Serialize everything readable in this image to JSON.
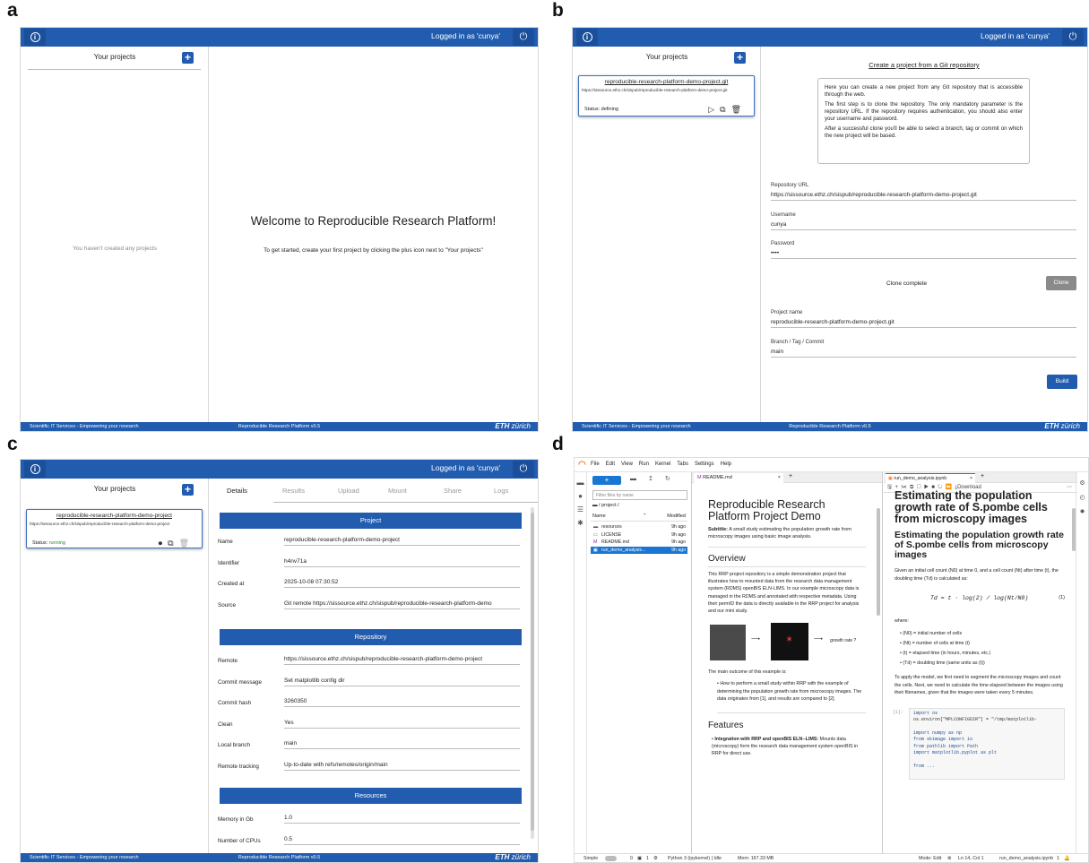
{
  "panels": {
    "a": "a",
    "b": "b",
    "c": "c",
    "d": "d"
  },
  "common": {
    "logged": "Logged in as 'cunya'",
    "info_glyph": "i",
    "power_glyph": "⏻",
    "plus_glyph": "+",
    "your_projects": "Your projects",
    "footer_left": "Scientific IT Services - Empowering your research",
    "footer_center": "Reproducible Research Platform v0.5",
    "footer_eth": "ETH",
    "footer_zurich": "zürich",
    "brand_color": "#215caf"
  },
  "panel_a": {
    "empty": "You haven't created any projects",
    "welcome": "Welcome to Reproducible Research Platform!",
    "hint": "To get started, create your first project by clicking the plus icon next to \"Your projects\""
  },
  "panel_b": {
    "card_title": "reproducible-research-platform-demo-project.git",
    "card_url": "https://sissource.ethz.ch/sispub/reproducible-research-platform-demo-project.git",
    "card_status": "Status: defining",
    "heading": "Create a project from a Git repository",
    "help1": "Here you can create a new project from any Git repository that is accessible through the web.",
    "help2": "The first step is to clone the repository. The only mandatory parameter is the repository URL. If the repository requires authentication, you should also enter your username and password.",
    "help3": "After a successful clone you'll be able to select a branch, tag or commit on which the new project will be based.",
    "repo_label": "Repository URL",
    "repo_value": "https://sissource.ethz.ch/sispub/reproducible-research-platform-demo-project.git",
    "user_label": "Username",
    "user_value": "cunya",
    "pass_label": "Password",
    "pass_value": "••••",
    "clone_status": "Clone complete",
    "clone_btn": "Clone",
    "name_label": "Project name",
    "name_value": "reproducible-research-platform-demo-project.git",
    "branch_label": "Branch / Tag / Commit",
    "branch_value": "main",
    "build_btn": "Build"
  },
  "panel_c": {
    "card_title": "reproducible-research-platform-demo-project",
    "card_url": "https://sissource.ethz.ch/sispub/reproducible-research-platform-demo-project",
    "card_status_label": "Status:",
    "card_status_value": "running",
    "tabs": [
      "Details",
      "Results",
      "Upload",
      "Mount",
      "Share",
      "Logs"
    ],
    "project_hdr": "Project",
    "repo_hdr": "Repository",
    "res_hdr": "Resources",
    "project": [
      {
        "k": "Name",
        "v": "reproducible-research-platform-demo-project"
      },
      {
        "k": "Identifier",
        "v": "h4nv71a"
      },
      {
        "k": "Created at",
        "v": "2025-10-08 07:30:52"
      },
      {
        "k": "Source",
        "v": "Git remote https://sissource.ethz.ch/sispub/reproducible-research-platform-demo"
      }
    ],
    "repo": [
      {
        "k": "Remote",
        "v": "https://sissource.ethz.ch/sispub/reproducible-research-platform-demo-project"
      },
      {
        "k": "Commit message",
        "v": "Set matplotlib config dir"
      },
      {
        "k": "Commit hash",
        "v": "3260350"
      },
      {
        "k": "Clean",
        "v": "Yes"
      },
      {
        "k": "Local branch",
        "v": "main"
      },
      {
        "k": "Remote tracking",
        "v": "Up-to-date with refs/remotes/origin/main"
      }
    ],
    "resources": [
      {
        "k": "Memory in Gb",
        "v": "1.0"
      },
      {
        "k": "Number of CPUs",
        "v": "0.5"
      }
    ]
  },
  "panel_d": {
    "menu": [
      "File",
      "Edit",
      "View",
      "Run",
      "Kernel",
      "Tabs",
      "Settings",
      "Help"
    ],
    "filter_placeholder": "Filter files by name",
    "path": "/ project /",
    "col_name": "Name",
    "col_modified": "Modified",
    "files": [
      {
        "name": "resources",
        "mod": "9h ago"
      },
      {
        "name": "LICENSE",
        "mod": "9h ago"
      },
      {
        "name": "README.md",
        "mod": "9h ago"
      },
      {
        "name": "run_demo_analysis...",
        "mod": "9h ago"
      }
    ],
    "readme_tab": "README.md",
    "nb_tab": "run_demo_analysis.ipynb",
    "download": "Download",
    "readme_title": "Reproducible Research Platform Project Demo",
    "subtitle_label": "Subtitle:",
    "subtitle": "A small study estimating the population growth rate from microscopy images using basic image analysis.",
    "overview": "Overview",
    "overview_text": "This RRP project repository is a simple demonstration project that illustrates how to mounted data from the research data management system (RDMS) openBIS ELN-LIMS. In our example microscopy data is managed in the RDMS and annotated with respective metadata. Using their permID the data is directly available in the RRP project for analysis and our mini study.",
    "growth_label": "growth rate ?",
    "outcome": "The main outcome of this example is:",
    "bullet1": "How to perform a small study within RRP with the example of determining the population growth rate from microscopy images. The data originates from [1], and results are compared to [2].",
    "features": "Features",
    "feat1_title": "Integration with RRP and openBIS ELN--LIMS:",
    "feat1": "Mounts data (microscopy) form the research data management system openBIS in RRP for direct use.",
    "nb_h1": "Estimating the population growth rate of S.pombe cells from microscopy images",
    "nb_h2": "Estimating the population growth rate of S.pombe cells from microscopy images",
    "nb_p1": "Given an initial cell count (N0) at time 0, and a cell count (Nt) after time (t), the doubling time (Td) is calculated as:",
    "formula": "Td = t · log(2) / log(Nt/N0)",
    "eq_num": "(1)",
    "where": "where:",
    "where_items": [
      "(N0) = initial number of cells",
      "(Nt) = number of cells at time (t)",
      "(t) = elapsed time (in hours, minutes, etc.)",
      "(Td) = doubling time (same units as (t))"
    ],
    "nb_p2": "To apply the model, we first need to segment the microscopy images and count the cells. Next, we need to calculate the time elapsed between the images using their filenames, given that the images were taken every 5 minutes.",
    "cell_prompt": "[1]:",
    "code": [
      "import os",
      "os.environ[\"MPLCONFIGDIR\"] = \"/tmp/matplotlib-",
      "",
      "import numpy as np",
      "from skimage import io",
      "from pathlib import Path",
      "import matplotlib.pyplot as plt",
      "",
      "from ..."
    ],
    "status_simple": "Simple",
    "status_kernel": "Python 3 (ipykernel) | Idle",
    "status_mem": "Mem: 167.33 MB",
    "status_mode": "Mode: Edit",
    "status_pos": "Ln 14, Col 1",
    "status_file": "run_demo_analysis.ipynb",
    "status_zero": "0",
    "status_one": "1",
    "status_count": "1"
  }
}
